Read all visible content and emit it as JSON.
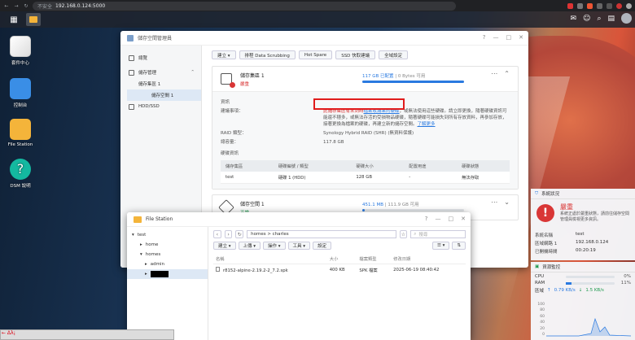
{
  "browser": {
    "security_label": "不安全",
    "url": "192.168.0.124:5000"
  },
  "desktop": {
    "icons": [
      {
        "label": "套件中心",
        "color": "#f0f0f0"
      },
      {
        "label": "控制台",
        "color": "#3a8ee6"
      },
      {
        "label": "File Station",
        "color": "#f4b43a"
      },
      {
        "label": "DSM 說明",
        "color": "#14b8a0"
      }
    ]
  },
  "storage": {
    "title": "儲存空間管理員",
    "sidebar": {
      "overview": "總覽",
      "storage": "儲存管理",
      "pool": "儲存集區 1",
      "volume": "儲存空間 1",
      "hdd": "HDD/SSD"
    },
    "toolbar": [
      "建立 ▾",
      "排程 Data Scrubbing",
      "Hot Spare",
      "SSD 快取建議",
      "全域設定"
    ],
    "pool": {
      "name": "儲存集區 1",
      "status": "嚴重",
      "used": "117 GB 已配置",
      "free": "0 Bytes 可用",
      "usage_fraction": 1.0,
      "info_title": "資訊",
      "notice_label": "建議事項：",
      "notice_pre": "此儲存集區有未到時",
      "notice_link": "檔案收滿果的硬碟",
      "notice_post": "，或無法使用這些硬碟。請立即更換，隨著硬碟資訊可能還不穩多，或無法存活的受損物品硬碟，隨著硬碟可能損失到所有存放資料，再參加存放，接著更換為檔案的硬碟，再建立新的儲存空間。",
      "notice_more": "了解更多",
      "raid_label": "RAID 類型：",
      "raid_value": "Synology Hybrid RAID (SHR) (無資料保護)",
      "capacity_label": "總容量：",
      "capacity_value": "117.8 GB",
      "disk_title": "硬碟資訊",
      "disk_headers": [
        "儲存集區",
        "硬碟編號 / 類型",
        "硬碟大小",
        "配置用途",
        "硬碟狀態"
      ],
      "disk_row": [
        "test",
        "硬碟 1 (HDD)",
        "128 GB",
        "-",
        "無法存取"
      ]
    },
    "volume": {
      "name": "儲存空間 1",
      "status": "正常",
      "used": "451.1 MB",
      "total": "111.9 GB 可用",
      "usage_fraction": 0.004
    }
  },
  "filestation": {
    "title": "File Station",
    "tree": {
      "root": "test",
      "home": "home",
      "homes": "homes",
      "admin": "admin"
    },
    "path": "homes > charles",
    "search_placeholder": "搜尋",
    "tools": [
      "建立 ▾",
      "上傳 ▾",
      "操作 ▾",
      "工具 ▾",
      "設定"
    ],
    "columns": [
      "名稱",
      "大小",
      "檔案類型",
      "修改日期"
    ],
    "files": [
      {
        "name": "r8152-alpine-2.19.2-2_7.2.spk",
        "size": "400 KB",
        "type": "SPK 檔案",
        "date": "2025-06-19 08:40:42"
      }
    ]
  },
  "system_status": {
    "title": "系統狀況",
    "status": "嚴重",
    "message": "系統正處於嚴重狀態，請前往儲存空間管理員檢視更多資訊。",
    "rows": [
      {
        "k": "系統名稱",
        "v": "test"
      },
      {
        "k": "區域網路 1",
        "v": "192.168.0.124"
      },
      {
        "k": "已開機時間",
        "v": "00:20:19"
      }
    ]
  },
  "resource_monitor": {
    "title": "資源監控",
    "cpu_label": "CPU",
    "cpu_value": "0%",
    "cpu_fraction": 0.0,
    "ram_label": "RAM",
    "ram_value": "11%",
    "ram_fraction": 0.11,
    "net_label": "區域",
    "upload": "0.79 KB/s",
    "download": "1.5 KB/s",
    "axis": [
      "100",
      "80",
      "60",
      "40",
      "20",
      "0"
    ]
  },
  "bottom_left_text": "← Δλ¡"
}
